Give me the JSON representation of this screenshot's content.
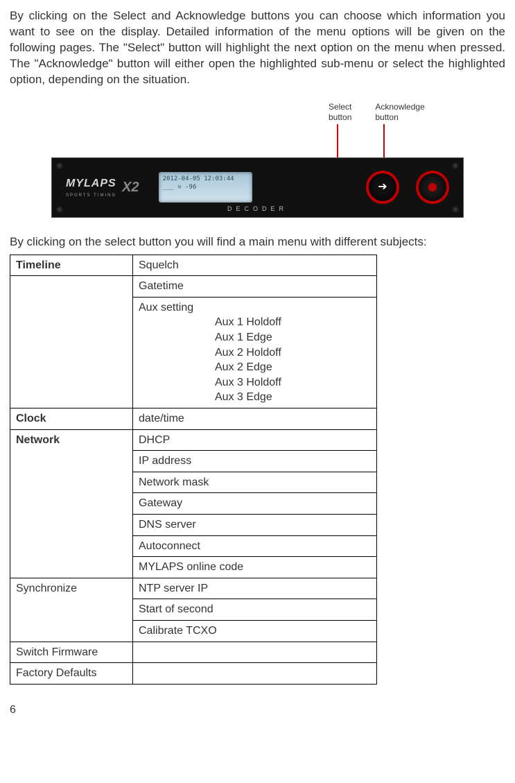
{
  "intro": "By clicking on the Select and Acknowledge buttons you can choose which information you want to see on the display. Detailed information of the menu options will be given on the following pages. The \"Select\" button will highlight the next option on the menu when pressed. The \"Acknowledge\" button will either open the highlighted sub-menu or select the highlighted option, depending on the situation.",
  "labels": {
    "select_l1": "Select",
    "select_l2": "button",
    "ack_l1": "Acknowledge",
    "ack_l2": "button"
  },
  "device": {
    "brand": "MYLAPS",
    "brand_sub": "SPORTS TIMING",
    "model": "X2",
    "lcd_top": "2012-04-05 12:03:44",
    "lcd_mid": "___   ⎋  -96",
    "decoder": "DECODER"
  },
  "subintro": "By clicking on the select button you will find a main menu with different subjects:",
  "table": {
    "timeline": "Timeline",
    "squelch": "Squelch",
    "gatetime": "Gatetime",
    "auxsetting": "Aux setting",
    "aux": [
      "Aux 1 Holdoff",
      "Aux 1 Edge",
      "Aux 2 Holdoff",
      "Aux 2 Edge",
      "Aux 3 Holdoff",
      "Aux 3 Edge"
    ],
    "clock": "Clock",
    "datetime": "date/time",
    "network": "Network",
    "net_items": [
      "DHCP",
      "IP address",
      "Network mask",
      "Gateway",
      "DNS server",
      "Autoconnect",
      "MYLAPS online code"
    ],
    "sync": "Synchronize",
    "ntp": "NTP server IP",
    "startsecond": "Start of second",
    "caltcxo": "Calibrate TCXO",
    "switchfw": "Switch Firmware",
    "factory": "Factory Defaults"
  },
  "pagenum": "6"
}
